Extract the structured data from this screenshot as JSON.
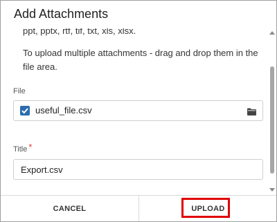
{
  "dialog": {
    "title": "Add Attachments"
  },
  "content": {
    "partial_line": "ppt, pptx, rtf, tif, txt, xls, xlsx.",
    "info_text": "To upload multiple attachments - drag and drop them in the file area.",
    "file_label": "File",
    "file": {
      "name": "useful_file.csv",
      "checked": true,
      "browse_icon": "folder-icon"
    },
    "title_label": "Title",
    "title_required_mark": "*",
    "title_value": "Export.csv"
  },
  "footer": {
    "cancel_label": "CANCEL",
    "upload_label": "UPLOAD"
  },
  "colors": {
    "accent": "#2b6cb0",
    "required": "#e53935",
    "highlight": "#e00000"
  }
}
